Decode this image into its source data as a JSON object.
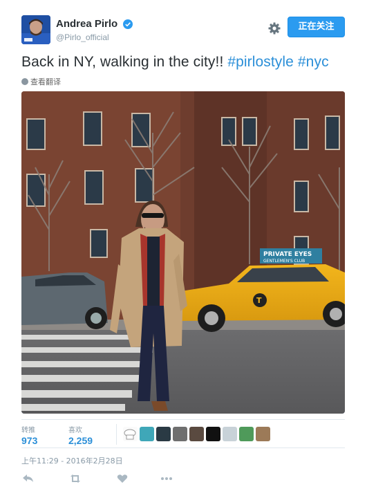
{
  "user": {
    "display_name": "Andrea Pirlo",
    "handle": "@Pirlo_official",
    "verified": true
  },
  "header": {
    "follow_label": "正在关注",
    "settings_icon": "gear-icon"
  },
  "tweet": {
    "text_main": "Back in NY, walking in the city!! ",
    "hashtags": [
      "#pirlostyle",
      "#nyc"
    ],
    "translate_label": "查看翻译",
    "photo_sign_1": "PRIVATE EYES",
    "photo_sign_2": "GENTLEMEN'S CLUB"
  },
  "stats": {
    "retweets_label": "转推",
    "retweets_count": "973",
    "likes_label": "喜欢",
    "likes_count": "2,259"
  },
  "timestamp": "上午11:29 - 2016年2月28日",
  "actions": [
    "reply-icon",
    "retweet-icon",
    "like-icon",
    "more-icon"
  ],
  "colors": {
    "accent": "#2b9bf0",
    "link": "#2b8fd8",
    "muted": "#8899a6"
  }
}
